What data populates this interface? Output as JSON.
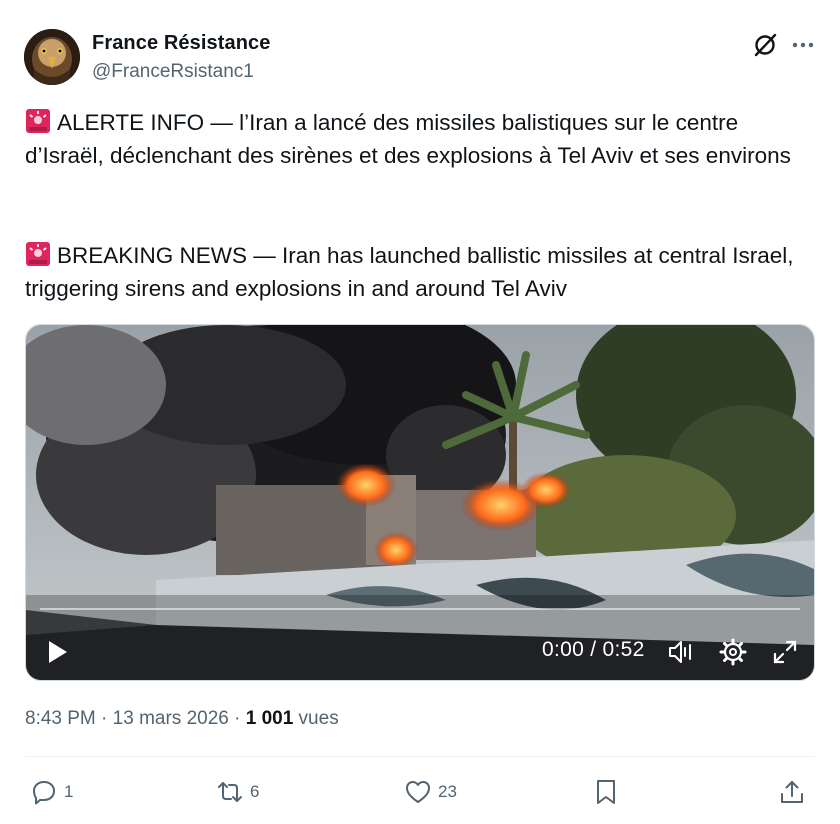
{
  "author": {
    "name": "France Résistance",
    "handle": "@FranceRsistanc1"
  },
  "icons": {
    "avatar": "eagle-avatar",
    "grok": "grok-icon",
    "more": "more-dots-icon",
    "siren": "rotating-light-emoji"
  },
  "post": {
    "paragraph1": "ALERTE INFO — l’Iran a lancé des missiles balistiques sur le centre d’Israël, déclenchant des sirènes et des explosions à Tel Aviv et ses environs",
    "paragraph2": "BREAKING NEWS — Iran has launched ballistic missiles at central Israel, triggering sirens and explosions in and around Tel Aviv"
  },
  "video": {
    "time_display": "0:00 / 0:52",
    "progress": 0
  },
  "meta": {
    "time": "8:43 PM",
    "separator": " · ",
    "date": "13 mars 2026",
    "views_count": "1 001",
    "views_label": " vues"
  },
  "actions": {
    "replies": "1",
    "reposts": "6",
    "likes": "23"
  },
  "colors": {
    "text": "#0f1419",
    "secondary": "#536471",
    "siren_red": "#e0245e"
  }
}
